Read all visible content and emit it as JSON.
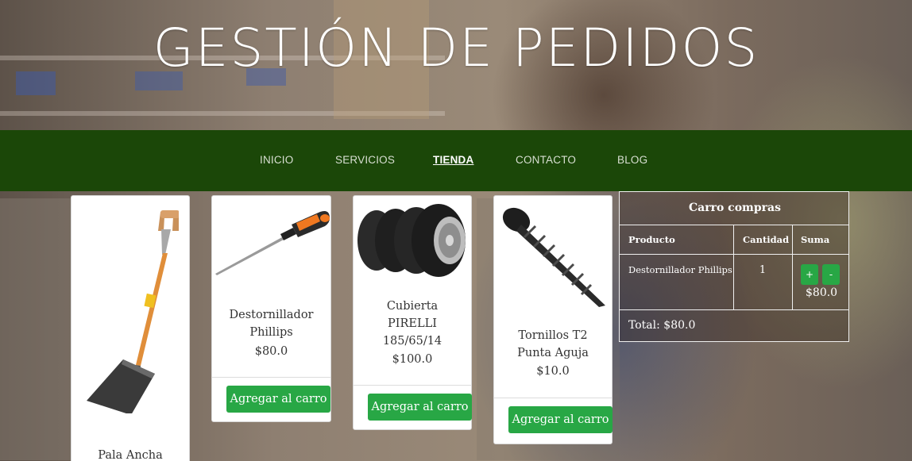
{
  "header": {
    "title": "GESTIÓN DE PEDIDOS"
  },
  "nav": {
    "items": [
      {
        "label": "INICIO",
        "active": false
      },
      {
        "label": "SERVICIOS",
        "active": false
      },
      {
        "label": "TIENDA",
        "active": true
      },
      {
        "label": "CONTACTO",
        "active": false
      },
      {
        "label": "BLOG",
        "active": false
      }
    ]
  },
  "products": [
    {
      "name_line1": "Pala Ancha",
      "name_line2": "",
      "name_line3": "",
      "price": "",
      "image": "shovel-image",
      "button": ""
    },
    {
      "name_line1": "Destornillador",
      "name_line2": "Phillips",
      "name_line3": "",
      "price": "$80.0",
      "image": "screwdriver-image",
      "button": "Agregar al carro"
    },
    {
      "name_line1": "Cubierta",
      "name_line2": "PIRELLI",
      "name_line3": "185/65/14",
      "price": "$100.0",
      "image": "tires-image",
      "button": "Agregar al carro"
    },
    {
      "name_line1": "Tornillos T2",
      "name_line2": "Punta Aguja",
      "name_line3": "",
      "price": "$10.0",
      "image": "screw-image",
      "button": "Agregar al carro"
    }
  ],
  "cart": {
    "title": "Carro compras",
    "columns": [
      "Producto",
      "Cantidad",
      "Suma"
    ],
    "rows": [
      {
        "product": "Destornillador Phillips",
        "quantity": "1",
        "plus": "+",
        "minus": "-",
        "sum": "$80.0"
      }
    ],
    "total": "Total: $80.0"
  },
  "colors": {
    "nav_bg": "#1b4708",
    "button_green": "#28a745"
  }
}
